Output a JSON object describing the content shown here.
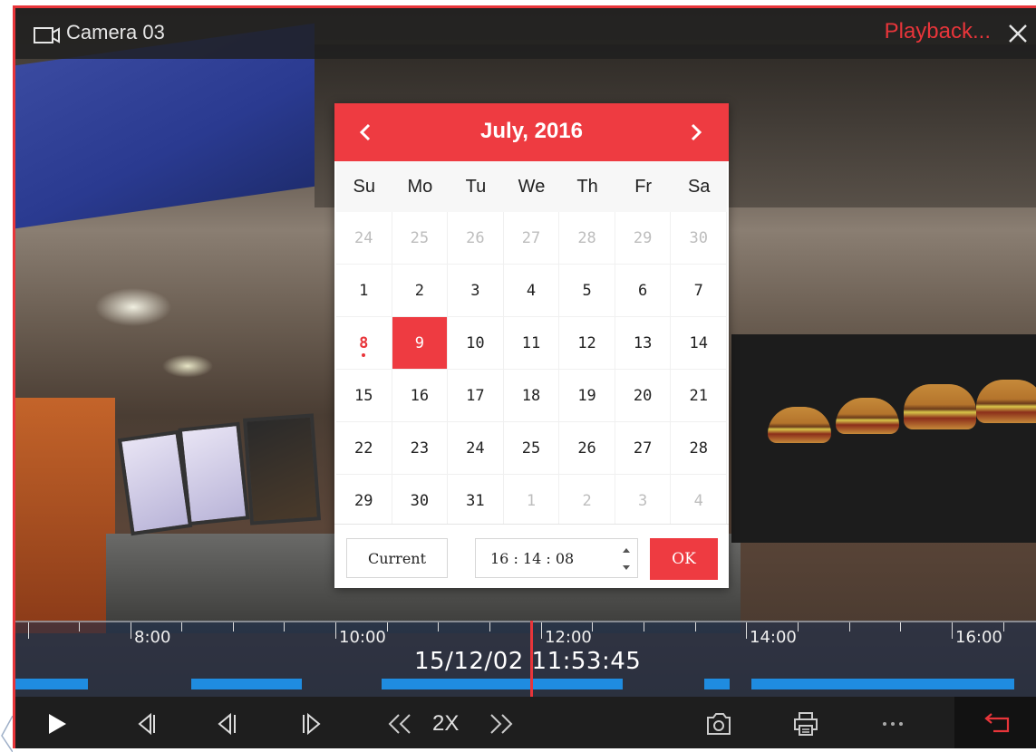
{
  "window": {
    "camera_title": "Camera 03",
    "mode_label": "Playback...",
    "icons": {
      "camera": "camera-icon",
      "close": "close-icon"
    }
  },
  "calendar": {
    "month_title": "July, 2016",
    "weekdays": [
      "Su",
      "Mo",
      "Tu",
      "We",
      "Th",
      "Fr",
      "Sa"
    ],
    "weeks": [
      [
        "24",
        "25",
        "26",
        "27",
        "28",
        "29",
        "30"
      ],
      [
        "1",
        "2",
        "3",
        "4",
        "5",
        "6",
        "7"
      ],
      [
        "8",
        "9",
        "10",
        "11",
        "12",
        "13",
        "14"
      ],
      [
        "15",
        "16",
        "17",
        "18",
        "19",
        "20",
        "21"
      ],
      [
        "22",
        "23",
        "24",
        "25",
        "26",
        "27",
        "28"
      ],
      [
        "29",
        "30",
        "31",
        "1",
        "2",
        "3",
        "4"
      ]
    ],
    "today": "8",
    "selected": "9",
    "current_button": "Current",
    "time_value": "16 : 14 : 08",
    "ok_button": "OK",
    "colors": {
      "accent": "#ee3b41"
    }
  },
  "timeline": {
    "labels": [
      "8:00",
      "10:00",
      "12:00",
      "14:00",
      "16:00"
    ],
    "timestamp": "15/12/02 11:53:45",
    "colors": {
      "recording": "#1f8ce0",
      "playhead": "#e8353a"
    }
  },
  "controls": {
    "speed": "2X",
    "icons": [
      "play-icon",
      "frame-back-icon",
      "step-back-icon",
      "step-forward-icon",
      "slower-icon",
      "faster-icon",
      "snapshot-icon",
      "print-icon",
      "more-icon",
      "exit-playback-icon"
    ]
  }
}
